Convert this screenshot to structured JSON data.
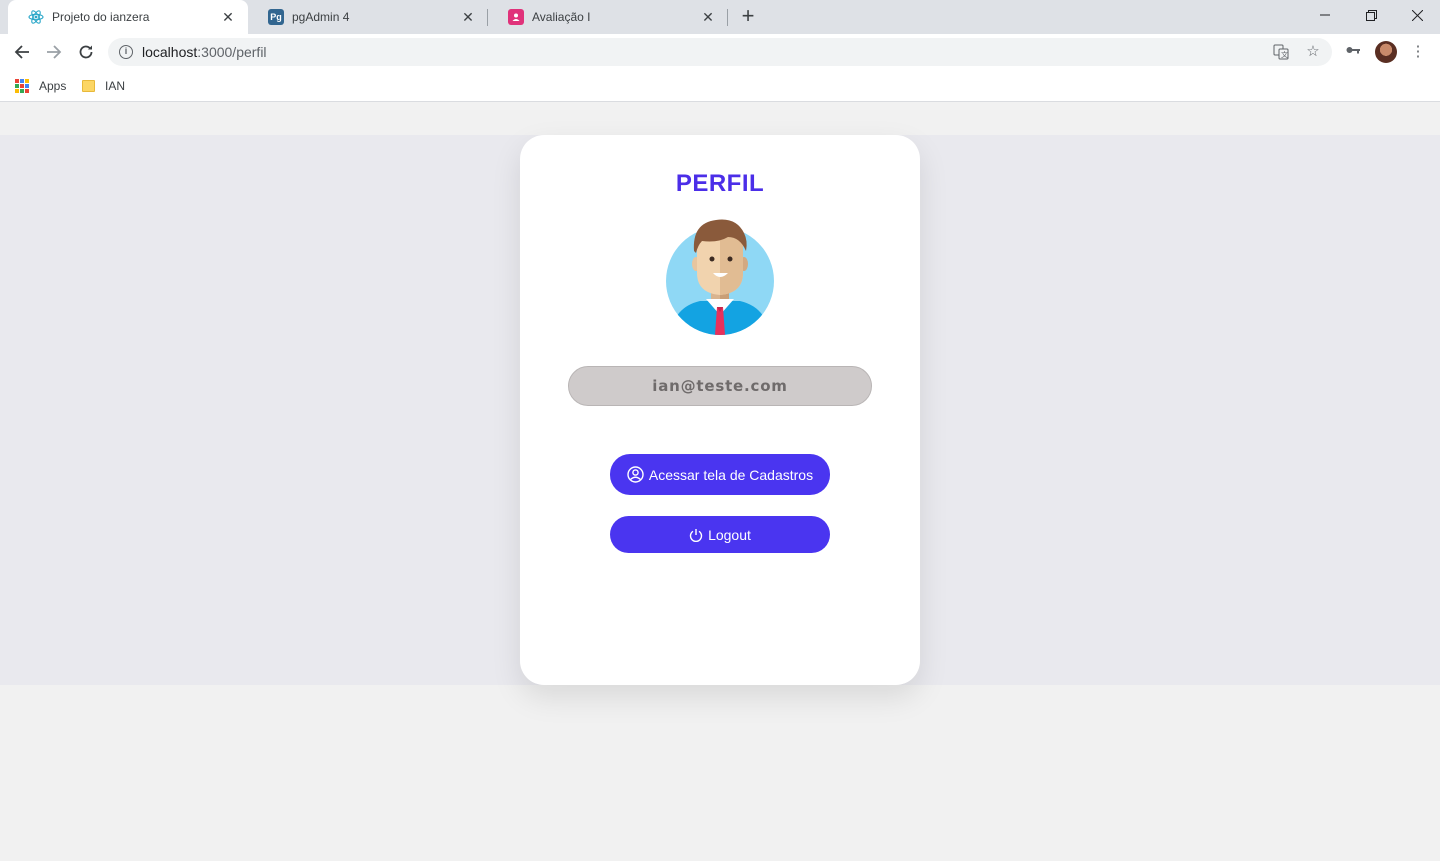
{
  "browser": {
    "tabs": [
      {
        "title": "Projeto do ianzera",
        "icon": "react-icon",
        "active": true
      },
      {
        "title": "pgAdmin 4",
        "icon": "pgadmin-icon",
        "active": false
      },
      {
        "title": "Avaliação I",
        "icon": "contact-icon",
        "active": false
      }
    ],
    "address": {
      "host": "localhost",
      "path": ":3000/perfil"
    },
    "bookmarks": [
      {
        "label": "Apps",
        "icon": "apps-grid-icon"
      },
      {
        "label": "IAN",
        "icon": "folder-icon"
      }
    ]
  },
  "perfil": {
    "title": "PERFIL",
    "email": "ian@teste.com",
    "cadastros_label": "Acessar tela de Cadastros",
    "logout_label": "Logout"
  },
  "colors": {
    "accent": "#4b2ee8",
    "button": "#4a35f0",
    "email_bg": "#cfcbcb"
  }
}
